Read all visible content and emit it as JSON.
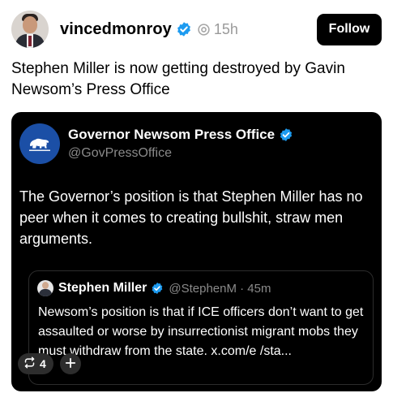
{
  "post": {
    "author": {
      "username": "vincedmonroy",
      "time": "15h",
      "avatar_icon": "profile-photo",
      "verified_icon": "verified-badge-icon"
    },
    "follow_label": "Follow",
    "text": "Stephen Miller is now getting destroyed by Gavin Newsom’s Press Office"
  },
  "quoted_post": {
    "author_name": "Governor Newsom Press Office",
    "handle": "@GovPressOffice",
    "avatar_icon": "california-bear-icon",
    "text": "The Governor’s position is that Stephen Miller has no peer when it comes to creating bullshit, straw men arguments.",
    "nested_quote": {
      "author_name": "Stephen Miller",
      "handle_time": "@StephenM · 45m",
      "text": "Newsom’s position is that if ICE officers don’t want to get assaulted or worse by insurrectionist migrant mobs they must withdraw from the state. x.com/e  /sta..."
    }
  },
  "actions": {
    "repost_count": "4",
    "repost_icon": "repost-icon",
    "add_icon": "plus-icon"
  },
  "colors": {
    "verified_blue": "#1d9bf0",
    "card_background": "#000000",
    "muted_text": "#8a8a8a",
    "california_flag_blue": "#1b4fa6"
  }
}
